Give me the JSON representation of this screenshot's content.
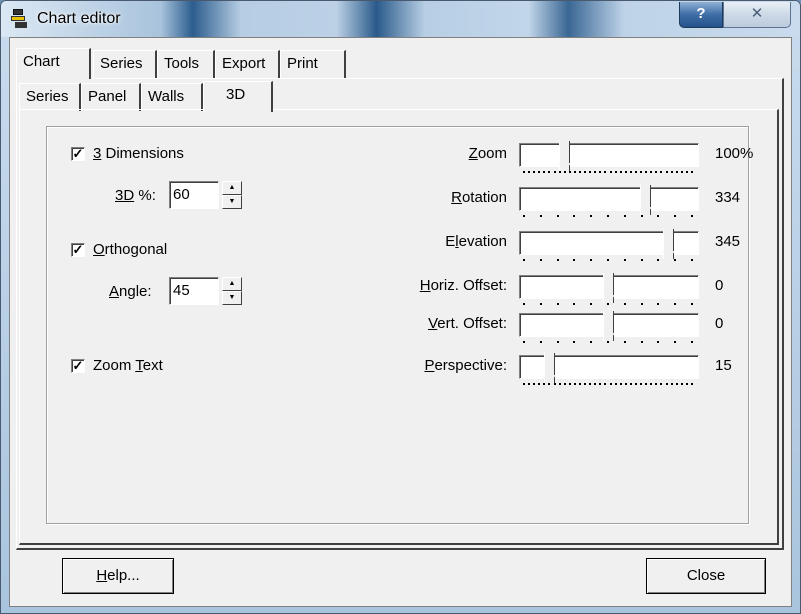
{
  "window": {
    "title": "Chart editor",
    "help_glyph": "?",
    "close_glyph": "✕"
  },
  "tabs_main": [
    {
      "label": "Chart",
      "active": true
    },
    {
      "label": "Series",
      "active": false
    },
    {
      "label": "Tools",
      "active": false
    },
    {
      "label": "Export",
      "active": false
    },
    {
      "label": "Print",
      "active": false
    }
  ],
  "tabs_sub": [
    {
      "label": "Series",
      "active": false
    },
    {
      "label": "Panel",
      "active": false
    },
    {
      "label": "Walls",
      "active": false
    },
    {
      "label": "3D",
      "active": true
    }
  ],
  "left": {
    "three_dimensions": {
      "checked": true,
      "pre": "",
      "key": "3",
      "post": " Dimensions"
    },
    "three_d_percent": {
      "pre": "",
      "key": "3D",
      "post": " %:",
      "value": "60"
    },
    "orthogonal": {
      "checked": true,
      "pre": "",
      "key": "O",
      "post": "rthogonal"
    },
    "angle": {
      "pre": "",
      "key": "A",
      "post": "ngle:",
      "value": "45"
    },
    "zoom_text": {
      "checked": true,
      "pre": "Zoom ",
      "key": "T",
      "post": "ext"
    }
  },
  "sliders": [
    {
      "pre": "",
      "key": "Z",
      "post": "oom",
      "value": "100%",
      "position": 0.24
    },
    {
      "pre": "",
      "key": "R",
      "post": "otation",
      "value": "334",
      "position": 0.72
    },
    {
      "pre": "E",
      "key": "l",
      "post": "evation",
      "value": "345",
      "position": 0.86
    },
    {
      "pre": "",
      "key": "H",
      "post": "oriz. Offset:",
      "value": "0",
      "position": 0.5
    },
    {
      "pre": "",
      "key": "V",
      "post": "ert. Offset:",
      "value": "0",
      "position": 0.5
    },
    {
      "pre": "",
      "key": "P",
      "post": "erspective:",
      "value": "15",
      "position": 0.15
    }
  ],
  "buttons": {
    "help_pre": "",
    "help_key": "H",
    "help_post": "elp...",
    "close": "Close"
  },
  "check_glyph": "✓"
}
